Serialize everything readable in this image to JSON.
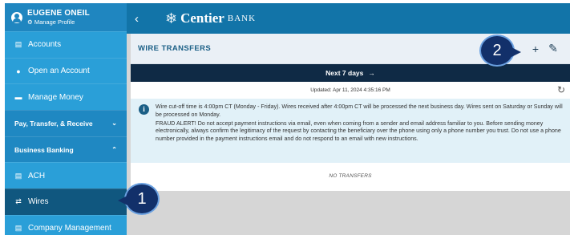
{
  "profile": {
    "name": "EUGENE ONEIL",
    "manage": "Manage Profile",
    "manage_icon": "gear-icon"
  },
  "sidebar": {
    "items": [
      {
        "label": "Accounts",
        "icon": "document-icon",
        "glyph": "▤"
      },
      {
        "label": "Open an Account",
        "icon": "plus-circle-icon",
        "glyph": "●"
      },
      {
        "label": "Manage Money",
        "icon": "money-icon",
        "glyph": "▬"
      },
      {
        "label": "Pay, Transfer, & Receive",
        "icon": "chevron-down-icon",
        "glyph": "⌄"
      },
      {
        "label": "Business Banking",
        "icon": "chevron-up-icon",
        "glyph": "⌃"
      },
      {
        "label": "ACH",
        "icon": "document-icon",
        "glyph": "▤"
      },
      {
        "label": "Wires",
        "icon": "transfer-icon",
        "glyph": "⇄"
      },
      {
        "label": "Company Management",
        "icon": "document-icon",
        "glyph": "▤"
      }
    ]
  },
  "header": {
    "back_glyph": "‹",
    "brand": "Centier",
    "brand_suffix": "BANK"
  },
  "main": {
    "title": "WIRE TRANSFERS",
    "add_glyph": "+",
    "edit_glyph": "✎",
    "range_label": "Next 7 days",
    "range_arrow": "→",
    "updated": "Updated: Apr 11, 2024 4:35:16 PM",
    "info_line1": "Wire cut-off time is 4:00pm CT (Monday - Friday). Wires received after 4:00pm CT will be processed the next business day. Wires sent on Saturday or Sunday will be processed on Monday.",
    "info_line2": "FRAUD ALERT! Do not accept payment instructions via email, even when coming from a sender and email address familiar to you. Before sending money electronically, always confirm the legitimacy of the request by contacting the beneficiary over the phone using only a phone number you trust. Do not use a phone number provided in the payment instructions email and do not respond to an email with new instructions.",
    "empty": "NO TRANSFERS"
  },
  "callouts": {
    "one": "1",
    "two": "2"
  },
  "colors": {
    "sidebar": "#2a9fd8",
    "topbar": "#1274a8",
    "active": "#10577f",
    "range_bar": "#0f2a45"
  }
}
